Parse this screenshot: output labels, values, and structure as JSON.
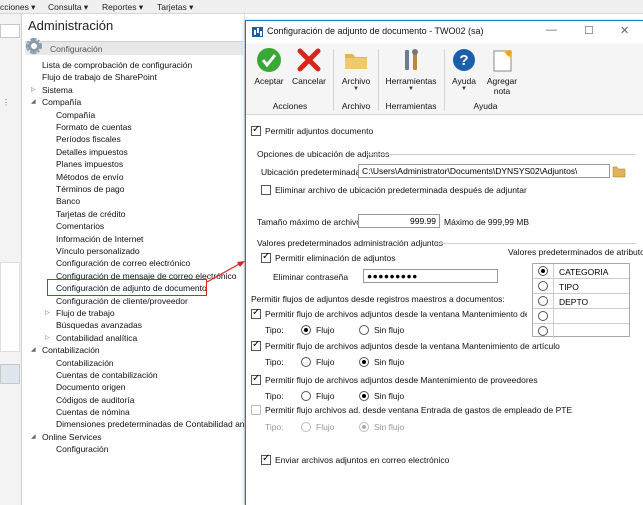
{
  "topbar": {
    "items": [
      "cciones ▾",
      "Consulta ▾",
      "Reportes ▾",
      "Tarjetas ▾"
    ]
  },
  "nav": {
    "title": "Administración",
    "header": "Configuración",
    "items": [
      {
        "label": "Lista de comprobación de configuración"
      },
      {
        "label": "Flujo de trabajo de SharePoint"
      },
      {
        "label": "Sistema"
      },
      {
        "label": "Compañía"
      },
      {
        "label": "Compañía"
      },
      {
        "label": "Formato de cuentas"
      },
      {
        "label": "Períodos fiscales"
      },
      {
        "label": "Detalles impuestos"
      },
      {
        "label": "Planes impuestos"
      },
      {
        "label": "Métodos de envío"
      },
      {
        "label": "Términos de pago"
      },
      {
        "label": "Banco"
      },
      {
        "label": "Tarjetas de crédito"
      },
      {
        "label": "Comentarios"
      },
      {
        "label": "Información de Internet"
      },
      {
        "label": "Vínculo personalizado"
      },
      {
        "label": "Configuración de correo electrónico"
      },
      {
        "label": "Configuración de mensaje de correo electrónico"
      },
      {
        "label": "Configuración de adjunto de documento"
      },
      {
        "label": "Configuración de cliente/proveedor"
      },
      {
        "label": "Flujo de trabajo"
      },
      {
        "label": "Búsquedas avanzadas"
      },
      {
        "label": "Contabilidad analítica"
      },
      {
        "label": "Contabilización"
      },
      {
        "label": "Contabilización"
      },
      {
        "label": "Cuentas de contabilización"
      },
      {
        "label": "Documento origen"
      },
      {
        "label": "Códigos de auditoría"
      },
      {
        "label": "Cuentas de nómina"
      },
      {
        "label": "Dimensiones predeterminadas de Contabilidad analítica"
      },
      {
        "label": "Online Services"
      },
      {
        "label": "Configuración"
      }
    ]
  },
  "dialog": {
    "title": "Configuración de adjunto de documento  -  TWO02 (sa)",
    "ribbon": {
      "accept": "Aceptar",
      "cancel": "Cancelar",
      "file": "Archivo",
      "tools": "Herramientas",
      "help": "Ayuda",
      "add_note_1": "Agregar",
      "add_note_2": "nota",
      "group_actions": "Acciones",
      "group_file": "Archivo",
      "group_tools": "Herramientas",
      "group_help": "Ayuda"
    },
    "allow_attachments": "Permitir adjuntos documento",
    "location_options": "Opciones de ubicación de adjuntos",
    "default_location_label": "Ubicación predeterminada:",
    "default_location_value": "C:\\Users\\Administrator\\Documents\\DYNSYS02\\Adjuntos\\",
    "delete_default_file": "Eliminar archivo de ubicación predeterminada después de adjuntar",
    "max_size_label": "Tamaño máximo de archivo",
    "max_size_value": "999.99",
    "max_size_note": "Máximo de 999,99 MB",
    "defaults_admin": "Valores predeterminados administración adjuntos",
    "allow_delete": "Permitir eliminación de adjuntos",
    "delete_password_label": "Eliminar contraseña",
    "delete_password_value": "●●●●●●●●●",
    "attr_defaults_label": "Valores predeterminados de atributo:",
    "attributes": [
      "CATEGORIA",
      "TIPO",
      "DEPTO",
      "",
      ""
    ],
    "allow_flows_label": "Permitir flujos de adjuntos desde registros maestros a documentos:",
    "flows": [
      {
        "label": "Permitir flujo de archivos adjuntos desde la ventana Mantenimiento de clier",
        "checked": true,
        "disabled": false,
        "type_label": "Tipo:",
        "opt_flow": "Flujo",
        "opt_noflow": "Sin flujo",
        "selected": "flow"
      },
      {
        "label": "Permitir flujo de archivos adjuntos desde la ventana Mantenimiento de artículo",
        "checked": true,
        "disabled": false,
        "type_label": "Tipo:",
        "opt_flow": "Flujo",
        "opt_noflow": "Sin flujo",
        "selected": "noflow"
      },
      {
        "label": "Permitir flujo de archivos adjuntos desde Mantenimiento de proveedores",
        "checked": true,
        "disabled": false,
        "type_label": "Tipo:",
        "opt_flow": "Flujo",
        "opt_noflow": "Sin flujo",
        "selected": "noflow"
      },
      {
        "label": "Permitir flujo archivos ad. desde ventana Entrada de gastos de empleado de PTE",
        "checked": false,
        "disabled": true,
        "type_label": "Tipo:",
        "opt_flow": "Flujo",
        "opt_noflow": "Sin flujo",
        "selected": "noflow"
      }
    ],
    "send_email": "Enviar archivos adjuntos en correo electrónico"
  },
  "colors": {
    "highlight_box": "#d9261c",
    "accept_green": "#3aa835",
    "cancel_red": "#d9261c",
    "title_icon_blue": "#1a5fa8"
  }
}
